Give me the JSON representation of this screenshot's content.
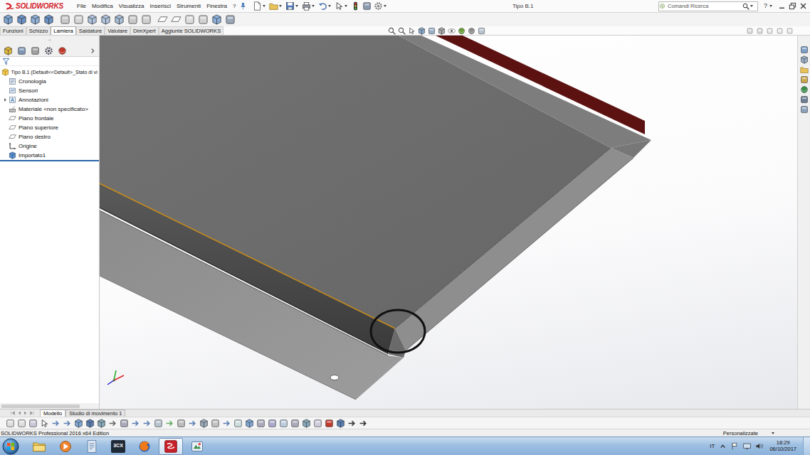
{
  "app": {
    "logo": "SOLIDWORKS",
    "menus": [
      "File",
      "Modifica",
      "Visualizza",
      "Inserisci",
      "Strumenti",
      "Finestra",
      "?"
    ],
    "title": "Tipo B.1",
    "search": {
      "placeholder": "Comandi Ricerca"
    },
    "help": "?"
  },
  "ribbon_tabs": [
    {
      "label": "Funzioni",
      "selected": false
    },
    {
      "label": "Schizzo",
      "selected": false
    },
    {
      "label": "Lamiera",
      "selected": true
    },
    {
      "label": "Saldature",
      "selected": false
    },
    {
      "label": "Valutare",
      "selected": false
    },
    {
      "label": "DimXpert",
      "selected": false
    },
    {
      "label": "Aggiunte SOLIDWORKS",
      "selected": false
    }
  ],
  "feature_tree": {
    "items": [
      {
        "label": "Tipo B.1  (Default<<Default>_Stato di vi",
        "kind": "root"
      },
      {
        "label": "Cronologia",
        "kind": "leaf"
      },
      {
        "label": "Sensori",
        "kind": "leaf"
      },
      {
        "label": "Annotazioni",
        "kind": "branch"
      },
      {
        "label": "Materiale <non specificato>",
        "kind": "leaf"
      },
      {
        "label": "Piano frontale",
        "kind": "leaf"
      },
      {
        "label": "Piano superiore",
        "kind": "leaf"
      },
      {
        "label": "Piano destro",
        "kind": "leaf"
      },
      {
        "label": "Origine",
        "kind": "leaf"
      },
      {
        "label": "Importato1",
        "kind": "leaf"
      }
    ]
  },
  "bottom_tabs": [
    {
      "label": "Modello",
      "selected": true
    },
    {
      "label": "Studio di movimento 1",
      "selected": false
    }
  ],
  "status_bar": {
    "product": "SOLIDWORKS Professional 2016 x64 Edition",
    "units": "Personalizzate"
  },
  "taskbar": {
    "apps": [
      {
        "active": false
      },
      {
        "active": false
      },
      {
        "active": false
      },
      {
        "active": false
      },
      {
        "active": false
      },
      {
        "active": true
      },
      {
        "active": false
      }
    ],
    "app_text": "3CX",
    "language": "IT",
    "time": "18:29",
    "date": "06/10/2017"
  }
}
